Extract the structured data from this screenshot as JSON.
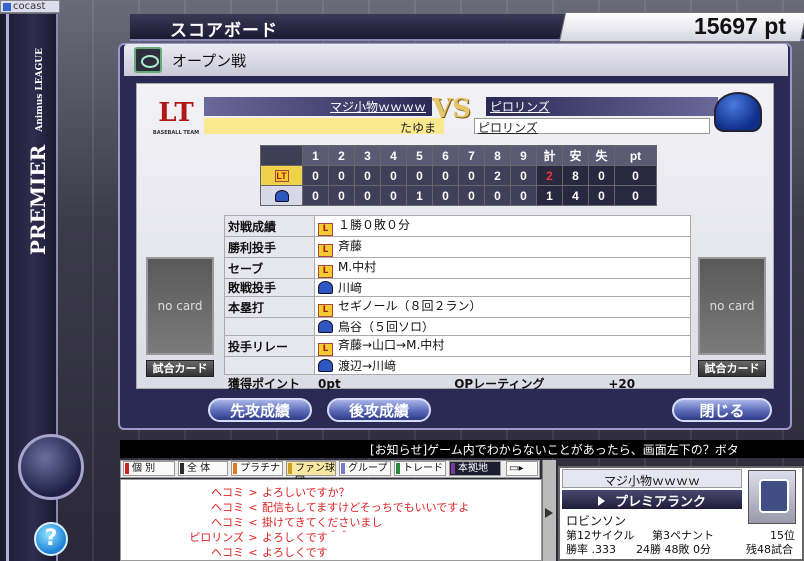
{
  "window": {
    "title": "cocast"
  },
  "header": {
    "title": "スコアボード",
    "points": "15697 pt"
  },
  "sidebar": {
    "brand": "PREMIER",
    "league": "Animus LEAGUE"
  },
  "game": {
    "type": "オープン戦"
  },
  "teams": {
    "home": {
      "name": "マジ小物ｗｗｗｗ",
      "player": "たゆま"
    },
    "vs": "VS",
    "away": {
      "name": "ピロリンズ",
      "player": "ピロリンズ"
    }
  },
  "scoreboard": {
    "innings": [
      "1",
      "2",
      "3",
      "4",
      "5",
      "6",
      "7",
      "8",
      "9"
    ],
    "total_headers": [
      "計",
      "安",
      "失",
      "pt"
    ],
    "rows": [
      {
        "team": "home",
        "scores": [
          "0",
          "0",
          "0",
          "0",
          "0",
          "0",
          "0",
          "2",
          "0"
        ],
        "totals": [
          "2",
          "8",
          "0",
          "0"
        ]
      },
      {
        "team": "away",
        "scores": [
          "0",
          "0",
          "0",
          "0",
          "1",
          "0",
          "0",
          "0",
          "0"
        ],
        "totals": [
          "1",
          "4",
          "0",
          "0"
        ]
      }
    ]
  },
  "results": {
    "record_label": "対戦成績",
    "record_value": "１勝０敗０分",
    "win_label": "勝利投手",
    "win_value": "斉藤",
    "save_label": "セーブ",
    "save_value": "M.中村",
    "loss_label": "敗戦投手",
    "loss_value": "川﨑",
    "hr_label": "本塁打",
    "hr_value_1": "セギノール（８回２ラン）",
    "hr_value_2": "鳥谷（５回ソロ）",
    "relay_label": "投手リレー",
    "relay_value_1": "斉藤→山口→M.中村",
    "relay_value_2": "渡辺→川﨑",
    "points_label": "獲得ポイント",
    "points_value": "0pt",
    "op_label": "OPレーティング",
    "op_value": "+20"
  },
  "cards": {
    "no_card": "no card",
    "button": "試合カード"
  },
  "buttons": {
    "first": "先攻成績",
    "second": "後攻成績",
    "close": "閉じる"
  },
  "notice": "[お知らせ]ゲーム内でわからないことがあったら、画面左下の？ボタ",
  "chat": {
    "tabs": [
      "個 別",
      "全 体",
      "プラチナ",
      "ファン球団",
      "グループ",
      "トレード",
      "本拠地"
    ],
    "tab_colors": [
      "#d02020",
      "#2a2a2a",
      "#e07a20",
      "#c9a020",
      "#7a7ad0",
      "#2a8a40",
      "#7a3a9a"
    ],
    "lines": [
      {
        "name": "ヘコミ",
        "sep": ">",
        "text": "よろしいですか？"
      },
      {
        "name": "ヘコミ",
        "sep": "<",
        "text": "配信もしてますけどそっちでもいいですよ"
      },
      {
        "name": "ヘコミ",
        "sep": "<",
        "text": "掛けてきてくださいまし"
      },
      {
        "name": "ピロリンズ",
        "sep": ">",
        "text": "よろしくです＾＾"
      },
      {
        "name": "ヘコミ",
        "sep": "<",
        "text": "よろしくです"
      }
    ]
  },
  "profile": {
    "name": "マジ小物ｗｗｗｗ",
    "rank": "プレミアランク",
    "team": "ロビンソン",
    "cycle": "第12サイクル",
    "pennant": "第3ペナント",
    "position": "15位",
    "rate": "勝率 .333",
    "record": "24勝 48敗 0分",
    "remaining": "残48試合"
  }
}
